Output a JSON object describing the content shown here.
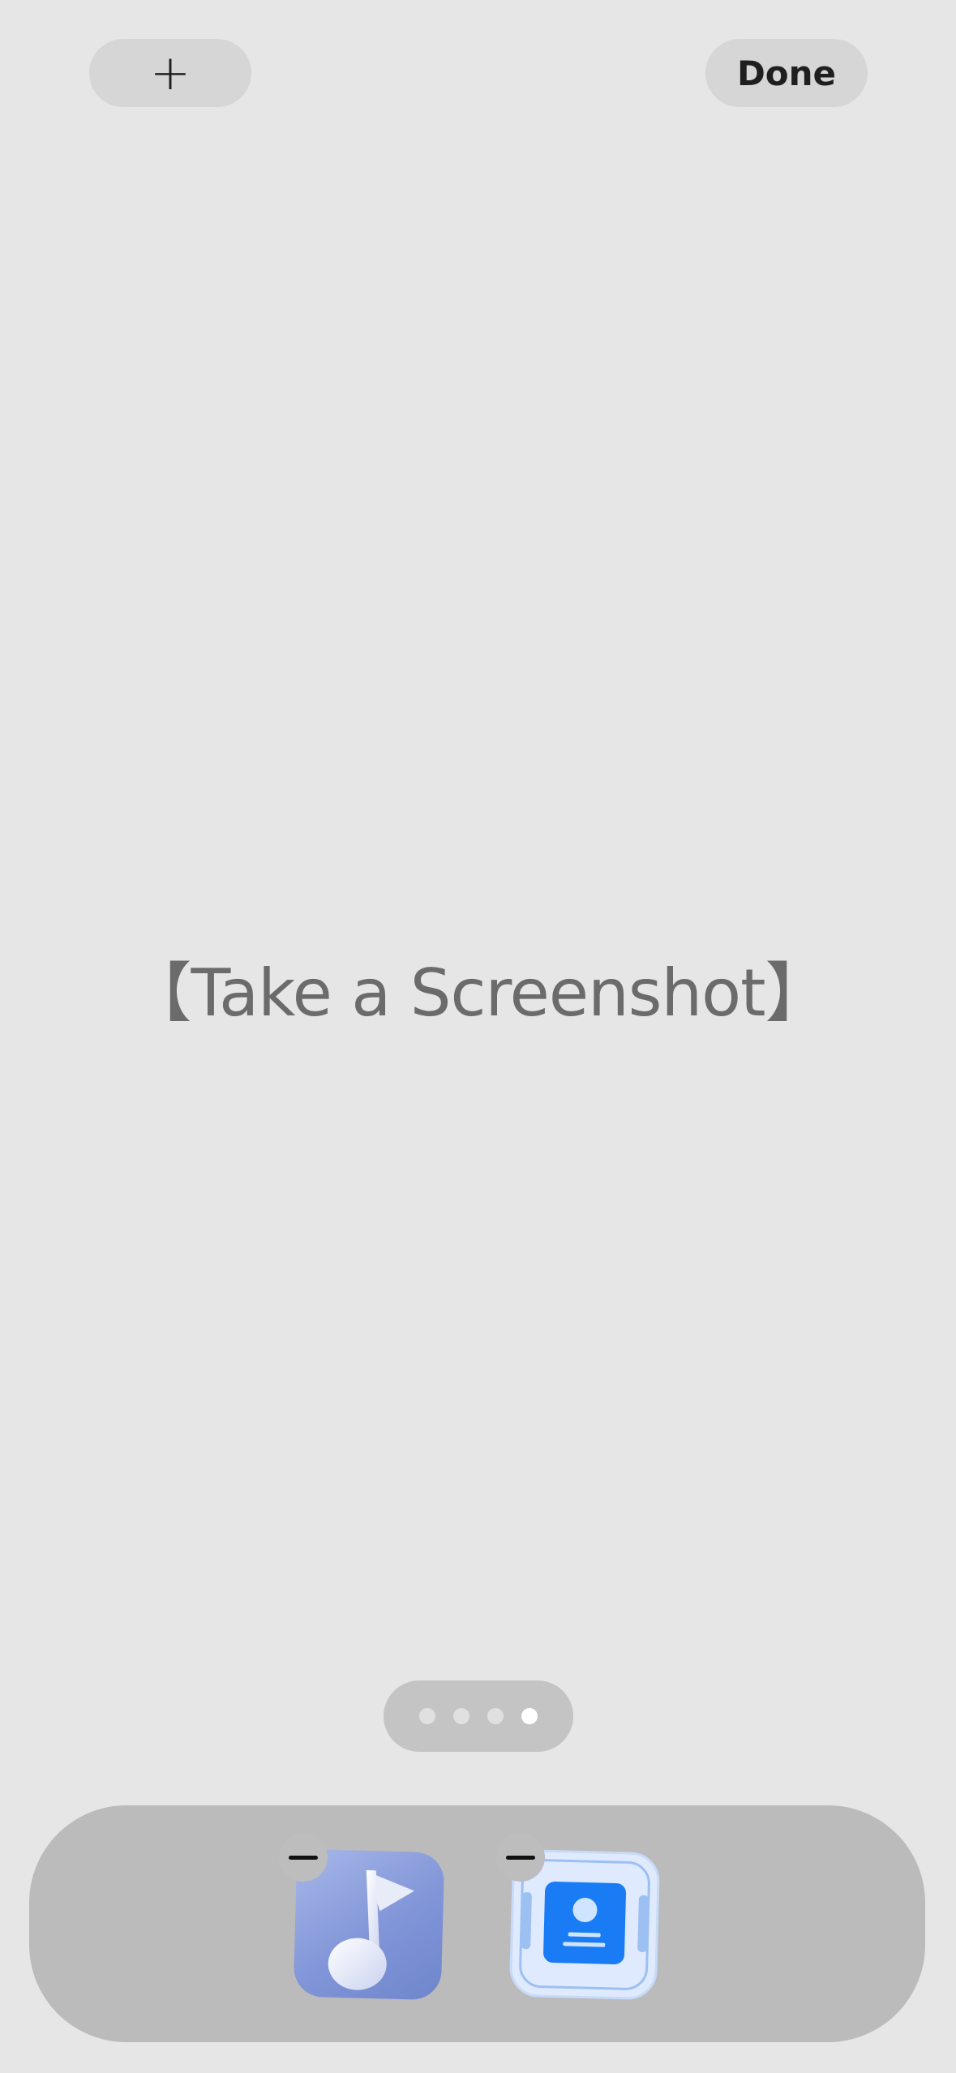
{
  "header": {
    "add_label": "+",
    "done_label": "Done"
  },
  "main": {
    "placeholder_text": "【Take a Screenshot】"
  },
  "page_indicator": {
    "total_pages": 4,
    "current_page": 4
  },
  "dock": {
    "apps": [
      {
        "name": "music",
        "icon": "music-note-icon",
        "color": "#8195d8"
      },
      {
        "name": "contacts",
        "icon": "contact-card-icon",
        "color": "#1a7cf5"
      }
    ],
    "remove_icon": "minus-icon"
  }
}
